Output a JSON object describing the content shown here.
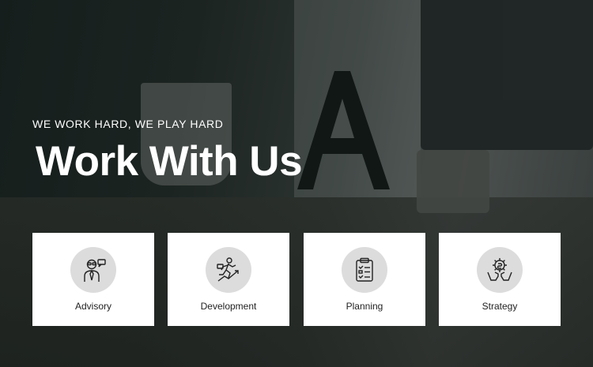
{
  "hero": {
    "eyebrow": "WE WORK HARD, WE PLAY HARD",
    "title": "Work With Us",
    "text_color": "#ffffff"
  },
  "cards": [
    {
      "label": "Advisory",
      "icon": "advisor-person-icon"
    },
    {
      "label": "Development",
      "icon": "running-growth-icon"
    },
    {
      "label": "Planning",
      "icon": "clipboard-checklist-icon"
    },
    {
      "label": "Strategy",
      "icon": "hands-gear-icon"
    }
  ],
  "colors": {
    "card_bg": "#ffffff",
    "icon_circle_bg": "#dcdcdc",
    "card_text": "#222222"
  }
}
